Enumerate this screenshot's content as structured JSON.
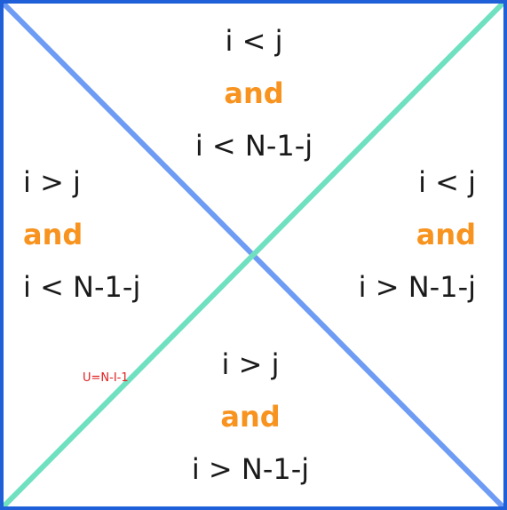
{
  "regions": {
    "top": {
      "line1": "i < j",
      "conj": "and",
      "line2": "i < N-1-j"
    },
    "left": {
      "line1": "i > j",
      "conj": "and",
      "line2": "i < N-1-j"
    },
    "right": {
      "line1": "i < j",
      "conj": "and",
      "line2": "i > N-1-j"
    },
    "bottom": {
      "line1": "i > j",
      "conj": "and",
      "line2": "i > N-1-j"
    }
  },
  "anti_diagonal_label": "U=N-I-1",
  "colors": {
    "border": "#1f5fd8",
    "main_diagonal": "#6e9cf4",
    "anti_diagonal": "#6fe0c0",
    "conjunction": "#f7931e",
    "text": "#1a1a1a",
    "label": "#e02020"
  }
}
